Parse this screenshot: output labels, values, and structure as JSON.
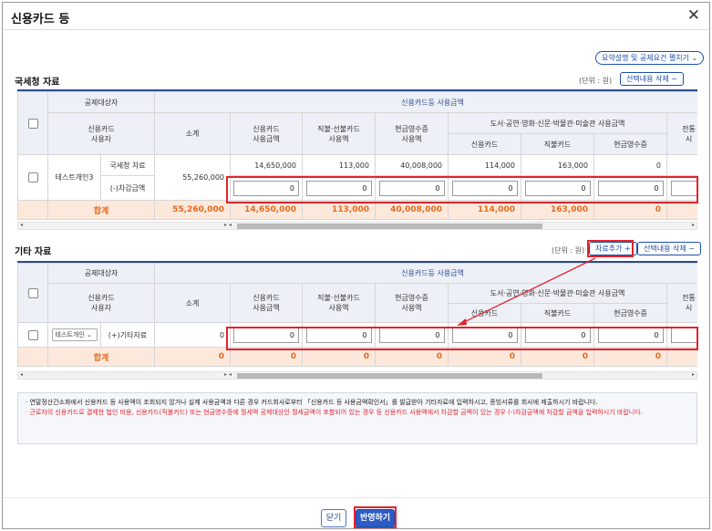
{
  "dialog": {
    "title": "신용카드 등",
    "close_glyph": "✕"
  },
  "summary_toggle": "요약설명 및 공제요건 펼치기",
  "chevron": "⌄",
  "nts": {
    "title": "국세청 자료",
    "unit": "(단위 : 원)",
    "delete_btn": "선택내용 삭제",
    "headers": {
      "target": "공제대상자",
      "user": "신용카드\n사용자",
      "group": "신용카드등 사용금액",
      "subtotal": "소계",
      "credit": "신용카드\n사용금액",
      "debit": "직불·선불카드\n사용액",
      "cash": "현금영수증\n사용액",
      "culture": "도서·공연·영화·신문·박물관·미술관 사용금액",
      "culture_credit": "신용카드",
      "culture_debit": "직불카드",
      "culture_cash": "현금영수증",
      "cut": "전통\n시"
    },
    "row": {
      "name": "테스트개인3",
      "type1": "국세청 자료",
      "type2": "(-)차감금액",
      "subtotal": "55,260,000",
      "credit": "14,650,000",
      "debit": "113,000",
      "cash": "40,008,000",
      "culture_credit": "114,000",
      "culture_debit": "163,000",
      "culture_cash": "0",
      "inputs": [
        "0",
        "0",
        "0",
        "0",
        "0",
        "0"
      ]
    },
    "sum": {
      "label": "합계",
      "subtotal": "55,260,000",
      "credit": "14,650,000",
      "debit": "113,000",
      "cash": "40,008,000",
      "culture_credit": "114,000",
      "culture_debit": "163,000",
      "culture_cash": "0"
    }
  },
  "other": {
    "title": "기타 자료",
    "unit": "(단위 : 원)",
    "add_btn": "자료추가 +",
    "delete_btn": "선택내용 삭제",
    "row": {
      "name_select": "테스트개인",
      "type": "(+)기타자료",
      "subtotal": "0",
      "inputs": [
        "0",
        "0",
        "0",
        "0",
        "0",
        "0"
      ]
    },
    "sum": {
      "label": "합계",
      "values": [
        "0",
        "0",
        "0",
        "0",
        "0",
        "0",
        "0"
      ]
    }
  },
  "notes": {
    "n1": "· 연말정산간소화에서 신용카드 등 사용액이 조회되지 않거나 실제 사용금액과 다른 경우 카드회사로부터 「신용카드 등 사용금액확인서」를 발급받아 기타자료에 입력하시고, 증빙서류를 회사에 제출하시기 바랍니다.",
    "n2": "· 근로자의 신용카드로 결제한 법인 비용, 신용카드(직불카드) 또는 현금영수증에 월세액 공제대상인 월세금액이 포함되어 있는 경우 등 신용카드 사용액에서 차감할 금액이 있는 경우 (-)차감금액에 차감할 금액을 입력하시기 바랍니다."
  },
  "footer": {
    "close": "닫기",
    "apply": "반영하기"
  },
  "scroll": {
    "left": "◂",
    "right": "▸",
    "mid": "▸ ◂"
  }
}
